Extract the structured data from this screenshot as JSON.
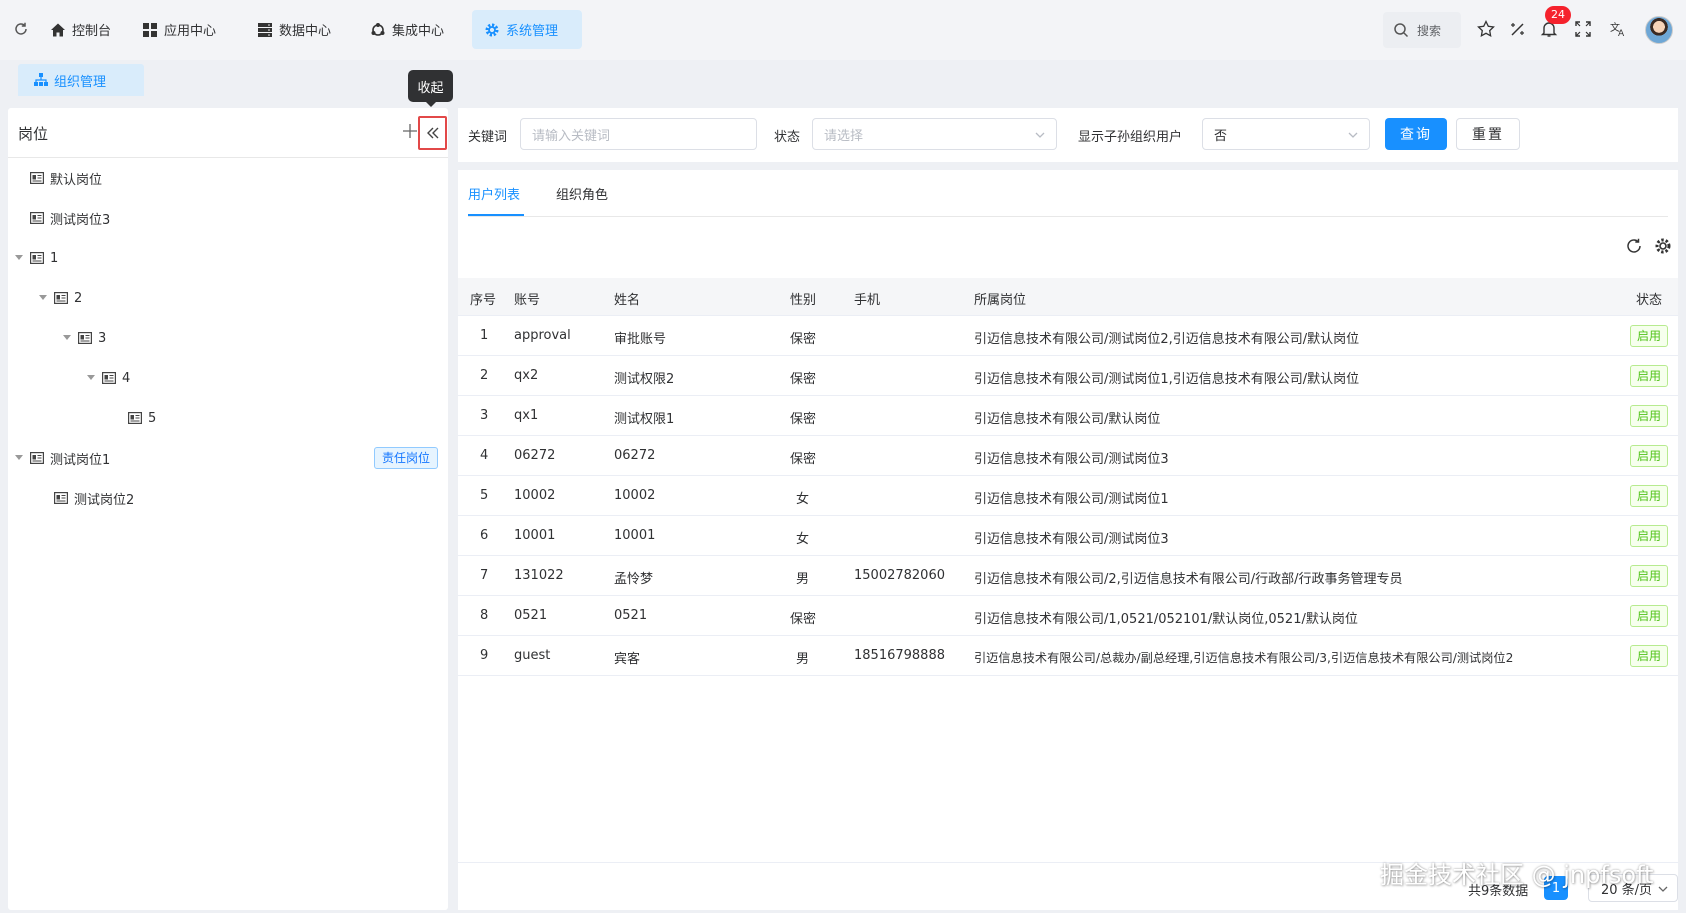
{
  "topbar": {
    "nav": [
      {
        "label": "控制台",
        "icon": "home-icon"
      },
      {
        "label": "应用中心",
        "icon": "grid-icon"
      },
      {
        "label": "数据中心",
        "icon": "database-icon"
      },
      {
        "label": "集成中心",
        "icon": "integration-icon"
      },
      {
        "label": "系统管理",
        "icon": "gear-icon"
      }
    ],
    "search_label": "搜索",
    "notification_count": "24"
  },
  "breadcrumb_tab": "组织管理",
  "tooltip": "收起",
  "left_panel": {
    "title": "岗位",
    "tree": [
      {
        "label": "默认岗位"
      },
      {
        "label": "测试岗位3"
      },
      {
        "label": "1"
      },
      {
        "label": "2"
      },
      {
        "label": "3"
      },
      {
        "label": "4"
      },
      {
        "label": "5"
      },
      {
        "label": "测试岗位1",
        "tag": "责任岗位"
      },
      {
        "label": "测试岗位2"
      }
    ]
  },
  "filters": {
    "keyword_label": "关键词",
    "keyword_placeholder": "请输入关键词",
    "status_label": "状态",
    "status_placeholder": "请选择",
    "show_sub_label": "显示子孙组织用户",
    "show_sub_value": "否",
    "query_button": "查询",
    "reset_button": "重置"
  },
  "tabs": [
    "用户列表",
    "组织角色"
  ],
  "table": {
    "headers": [
      "序号",
      "账号",
      "姓名",
      "性别",
      "手机",
      "所属岗位",
      "状态"
    ],
    "rows": [
      [
        "1",
        "approval",
        "审批账号",
        "保密",
        "",
        "引迈信息技术有限公司/测试岗位2,引迈信息技术有限公司/默认岗位",
        "启用"
      ],
      [
        "2",
        "qx2",
        "测试权限2",
        "保密",
        "",
        "引迈信息技术有限公司/测试岗位1,引迈信息技术有限公司/默认岗位",
        "启用"
      ],
      [
        "3",
        "qx1",
        "测试权限1",
        "保密",
        "",
        "引迈信息技术有限公司/默认岗位",
        "启用"
      ],
      [
        "4",
        "06272",
        "06272",
        "保密",
        "",
        "引迈信息技术有限公司/测试岗位3",
        "启用"
      ],
      [
        "5",
        "10002",
        "10002",
        "女",
        "",
        "引迈信息技术有限公司/测试岗位1",
        "启用"
      ],
      [
        "6",
        "10001",
        "10001",
        "女",
        "",
        "引迈信息技术有限公司/测试岗位3",
        "启用"
      ],
      [
        "7",
        "131022",
        "孟怜梦",
        "男",
        "15002782060",
        "引迈信息技术有限公司/2,引迈信息技术有限公司/行政部/行政事务管理专员",
        "启用"
      ],
      [
        "8",
        "0521",
        "0521",
        "保密",
        "",
        "引迈信息技术有限公司/1,0521/052101/默认岗位,0521/默认岗位",
        "启用"
      ],
      [
        "9",
        "guest",
        "宾客",
        "男",
        "18516798888",
        "引迈信息技术有限公司/总裁办/副总经理,引迈信息技术有限公司/3,引迈信息技术有限公司/测试岗位2",
        "启用"
      ]
    ]
  },
  "pagination": {
    "total_text": "共9条数据",
    "current_page": "1",
    "page_size": "20 条/页"
  },
  "watermark": "掘金技术社区 @ jnpfsoft",
  "colors": {
    "primary": "#1890ff",
    "success": "#52c41a",
    "danger": "#f5222d"
  }
}
